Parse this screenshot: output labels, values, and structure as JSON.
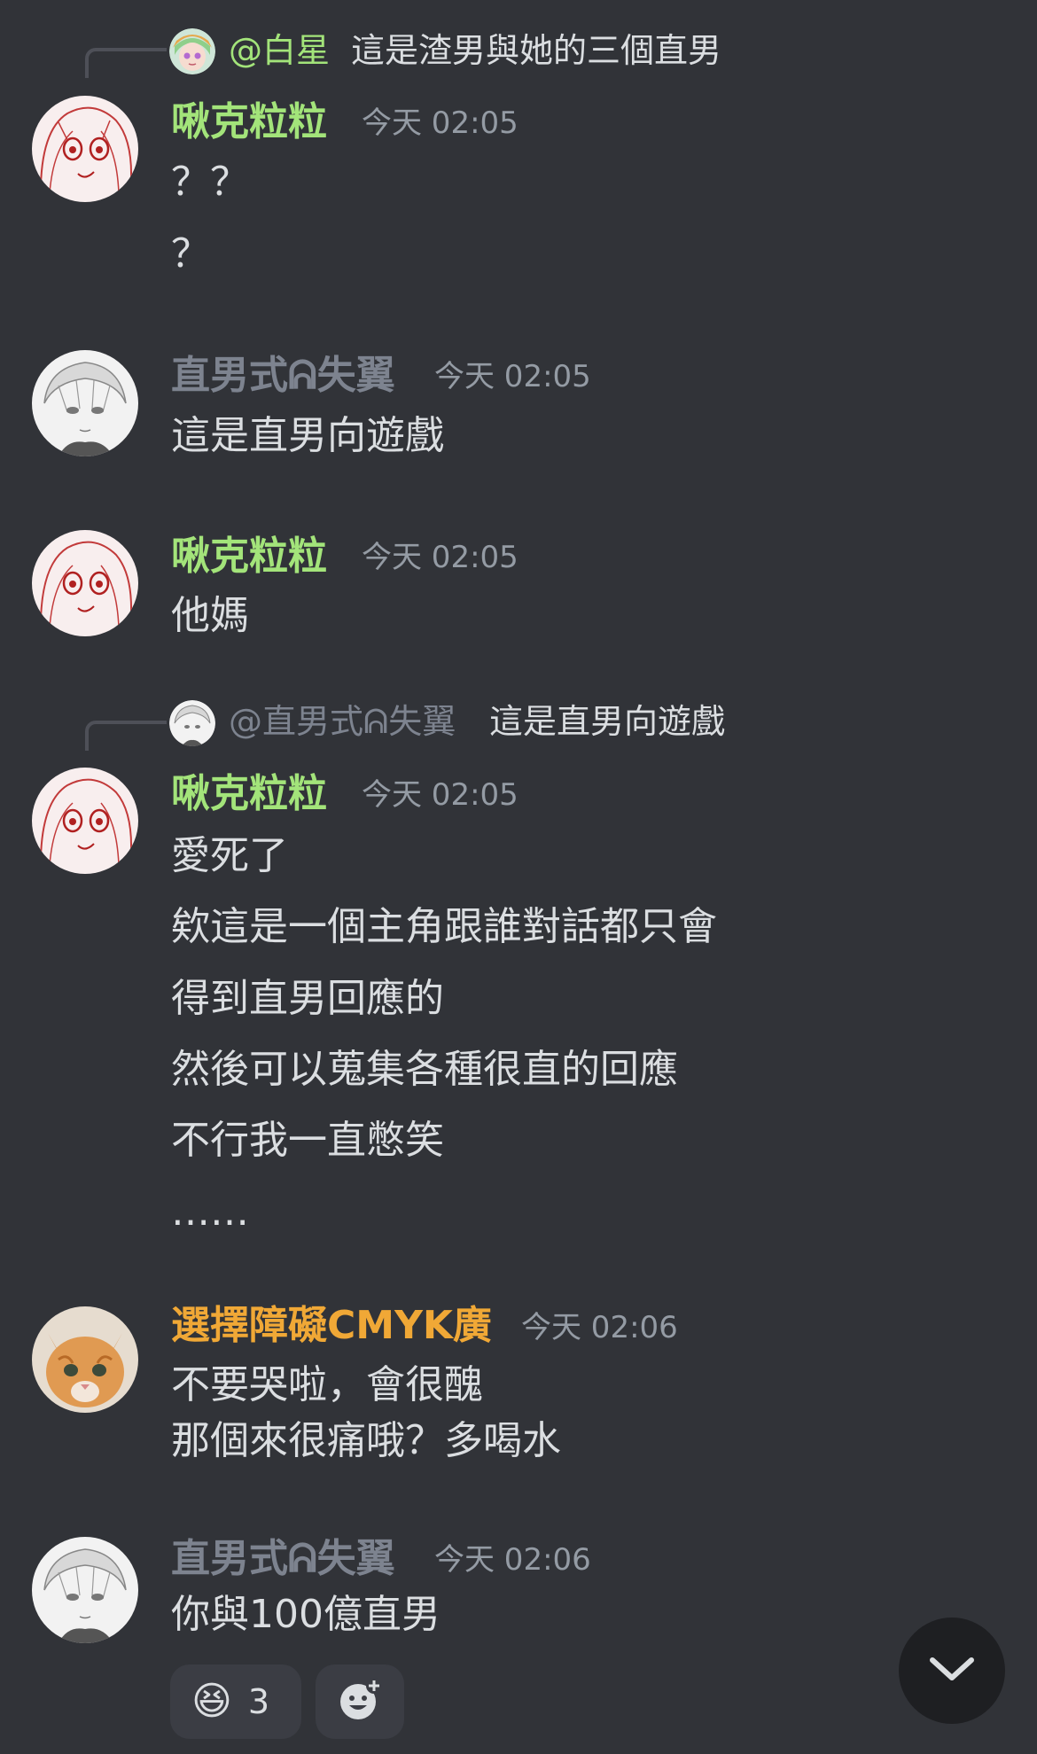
{
  "colors": {
    "background": "#313338",
    "green_name": "#a3e47a",
    "gray_name": "#7d838f",
    "orange_name": "#f0a836",
    "text": "#dbdee1",
    "muted": "#949ba4"
  },
  "messages": [
    {
      "reply": {
        "name": "@白星",
        "text": "這是渣男與她的三個直男",
        "avatar_icon": "anime-avatar-icon"
      },
      "author": "啾克粒粒",
      "time": "今天 02:05",
      "lines": [
        "？？",
        "？"
      ],
      "avatar_icon": "sketch-girl-avatar-icon"
    },
    {
      "author": "直男式ᕱ失翼",
      "time": "今天 02:05",
      "lines": [
        "這是直男向遊戲"
      ],
      "avatar_icon": "sketch-boy-avatar-icon"
    },
    {
      "author": "啾克粒粒",
      "time": "今天 02:05",
      "lines": [
        "他媽"
      ],
      "avatar_icon": "sketch-girl-avatar-icon"
    },
    {
      "reply": {
        "name": "@直男式ᕱ失翼",
        "text": "這是直男向遊戲",
        "avatar_icon": "sketch-boy-avatar-icon"
      },
      "author": "啾克粒粒",
      "time": "今天 02:05",
      "lines": [
        "愛死了",
        "欸這是一個主角跟誰對話都只會",
        "得到直男回應的",
        "然後可以蒐集各種很直的回應",
        "不行我一直憋笑",
        "……"
      ],
      "avatar_icon": "sketch-girl-avatar-icon"
    },
    {
      "author": "選擇障礙CMYK廣",
      "time": "今天 02:06",
      "lines": [
        "不要哭啦，會很醜",
        "那個來很痛哦？多喝水"
      ],
      "avatar_icon": "cat-avatar-icon"
    },
    {
      "author": "直男式ᕱ失翼",
      "time": "今天 02:06",
      "lines": [
        "你與100億直男"
      ],
      "avatar_icon": "sketch-boy-avatar-icon"
    }
  ],
  "reactions": [
    {
      "emoji": "😆",
      "count": "3"
    },
    {
      "icon": "add-reaction-icon"
    }
  ],
  "scroll_button_icon": "chevron-down-icon"
}
